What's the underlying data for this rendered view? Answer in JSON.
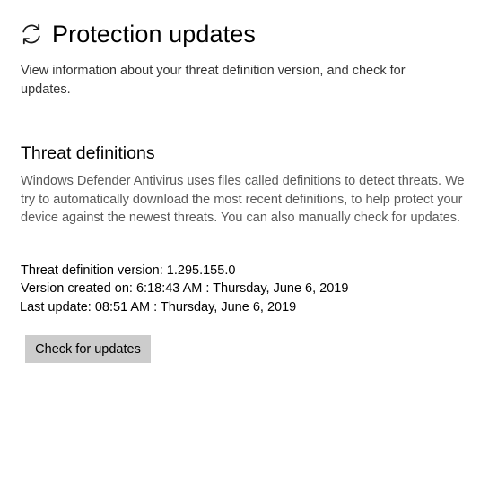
{
  "header": {
    "icon": "refresh-icon",
    "title": "Protection updates"
  },
  "intro": {
    "text": "View information about your threat definition version, and check for updates."
  },
  "threat_definitions": {
    "heading": "Threat definitions",
    "description": "Windows Defender Antivirus uses files called definitions to detect threats. We try to automatically download the most recent definitions, to help protect your device against the newest threats. You can also manually check for updates.",
    "version_line": "Threat definition version: 1.295.155.0",
    "created_line": "Version created on: 6:18:43 AM : Thursday, June 6, 2019",
    "last_update_line": "Last update: 08:51 AM : Thursday, June 6, 2019",
    "check_button_label": "Check for updates"
  },
  "colors": {
    "button_bg": "#cccccc",
    "secondary_text": "#595959"
  }
}
